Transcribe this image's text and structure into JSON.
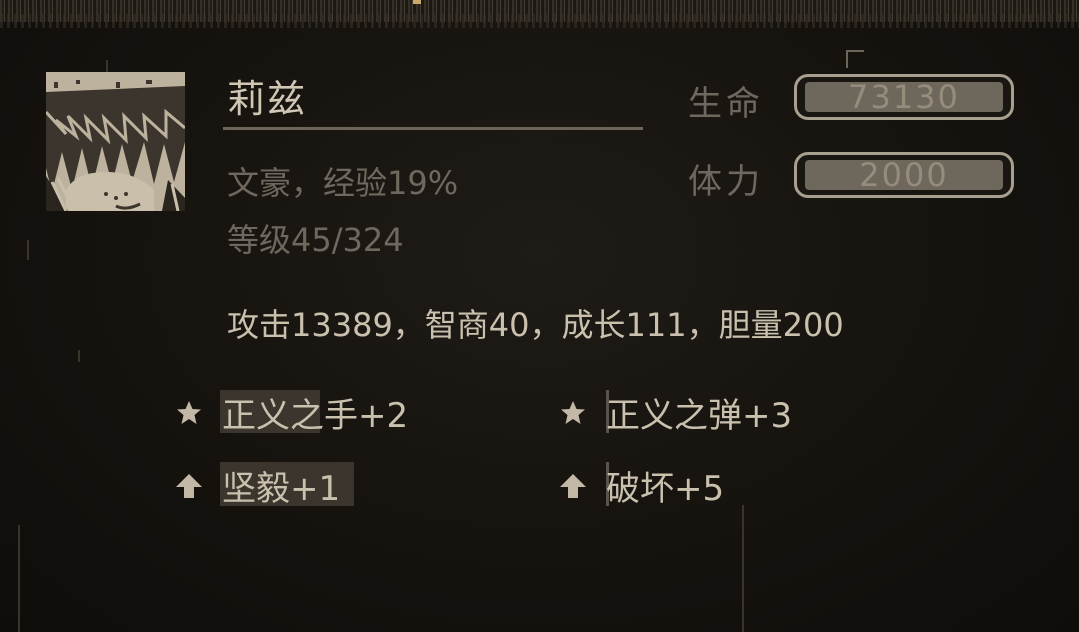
{
  "character": {
    "name": "莉兹",
    "subtitle": "文豪，经验19%",
    "level": "等级45/324",
    "attributes": "攻击13389，智商40，成长111，胆量200"
  },
  "stats": {
    "hp_label": "生命",
    "hp_value": "73130",
    "stamina_label": "体力",
    "stamina_value": "2000"
  },
  "skills": [
    {
      "label": "正义之手+2",
      "icon": "star-icon"
    },
    {
      "label": "正义之弹+3",
      "icon": "star-icon"
    },
    {
      "label": "坚毅+1",
      "icon": "up-arrow-icon"
    },
    {
      "label": "破坏+5",
      "icon": "up-arrow-icon"
    }
  ],
  "colors": {
    "background": "#14110d",
    "text_bright": "#c9c1ae",
    "text_dim": "#6f685e",
    "bar_border": "#a8a08f",
    "bar_fill": "#6e675c"
  }
}
